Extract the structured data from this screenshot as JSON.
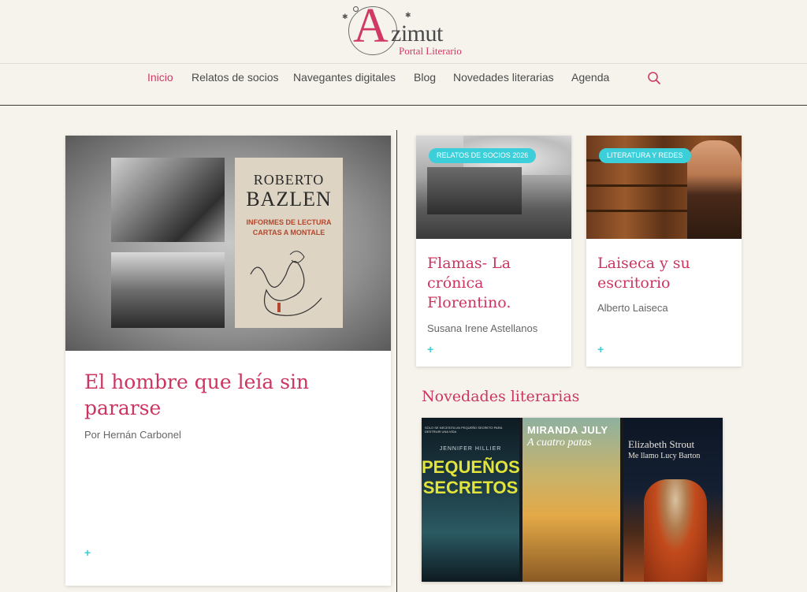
{
  "site": {
    "logo_word": "zimut",
    "logo_letter": "A",
    "logo_subtitle": "Portal Literario"
  },
  "nav": {
    "items": [
      {
        "label": "Inicio",
        "active": true
      },
      {
        "label": "Relatos de socios",
        "active": false
      },
      {
        "label": "Navegantes digitales",
        "active": false
      },
      {
        "label": "Blog",
        "active": false
      },
      {
        "label": "Novedades literarias",
        "active": false
      },
      {
        "label": "Agenda",
        "active": false
      }
    ],
    "search_icon": "search-icon"
  },
  "featured": {
    "image_text": {
      "line1": "ROBERTO",
      "line2": "BAZLEN",
      "line3": "INFORMES DE LECTURA",
      "line4": "CARTAS A MONTALE"
    },
    "title": "El hombre que leía sin pararse",
    "author": "Por Hernán Carbonel",
    "more": "+"
  },
  "cards": [
    {
      "tag": "RELATOS DE SOCIOS 2026",
      "title": "Flamas- La crónica Florentino.",
      "author": "Susana Irene Astellanos",
      "more": "+"
    },
    {
      "tag": "LITERATURA Y REDES",
      "title": "Laiseca y su escritorio",
      "author": "Alberto Laiseca",
      "more": "+"
    }
  ],
  "novedades": {
    "heading": "Novedades literarias",
    "books": [
      {
        "top": "SOLO SE NECESITA UN PEQUEÑO SECRETO PARA DESTRUIR UNA VIDA",
        "author": "JENNIFER HILLIER",
        "title": "PEQUEÑOS SECRETOS"
      },
      {
        "author": "MIRANDA JULY",
        "title": "A cuatro patas"
      },
      {
        "author": "Elizabeth Strout",
        "title": "Me llamo Lucy Barton"
      }
    ]
  },
  "colors": {
    "accent": "#cc3560",
    "tag": "#3ccfd9",
    "background": "#f6f3ec"
  }
}
